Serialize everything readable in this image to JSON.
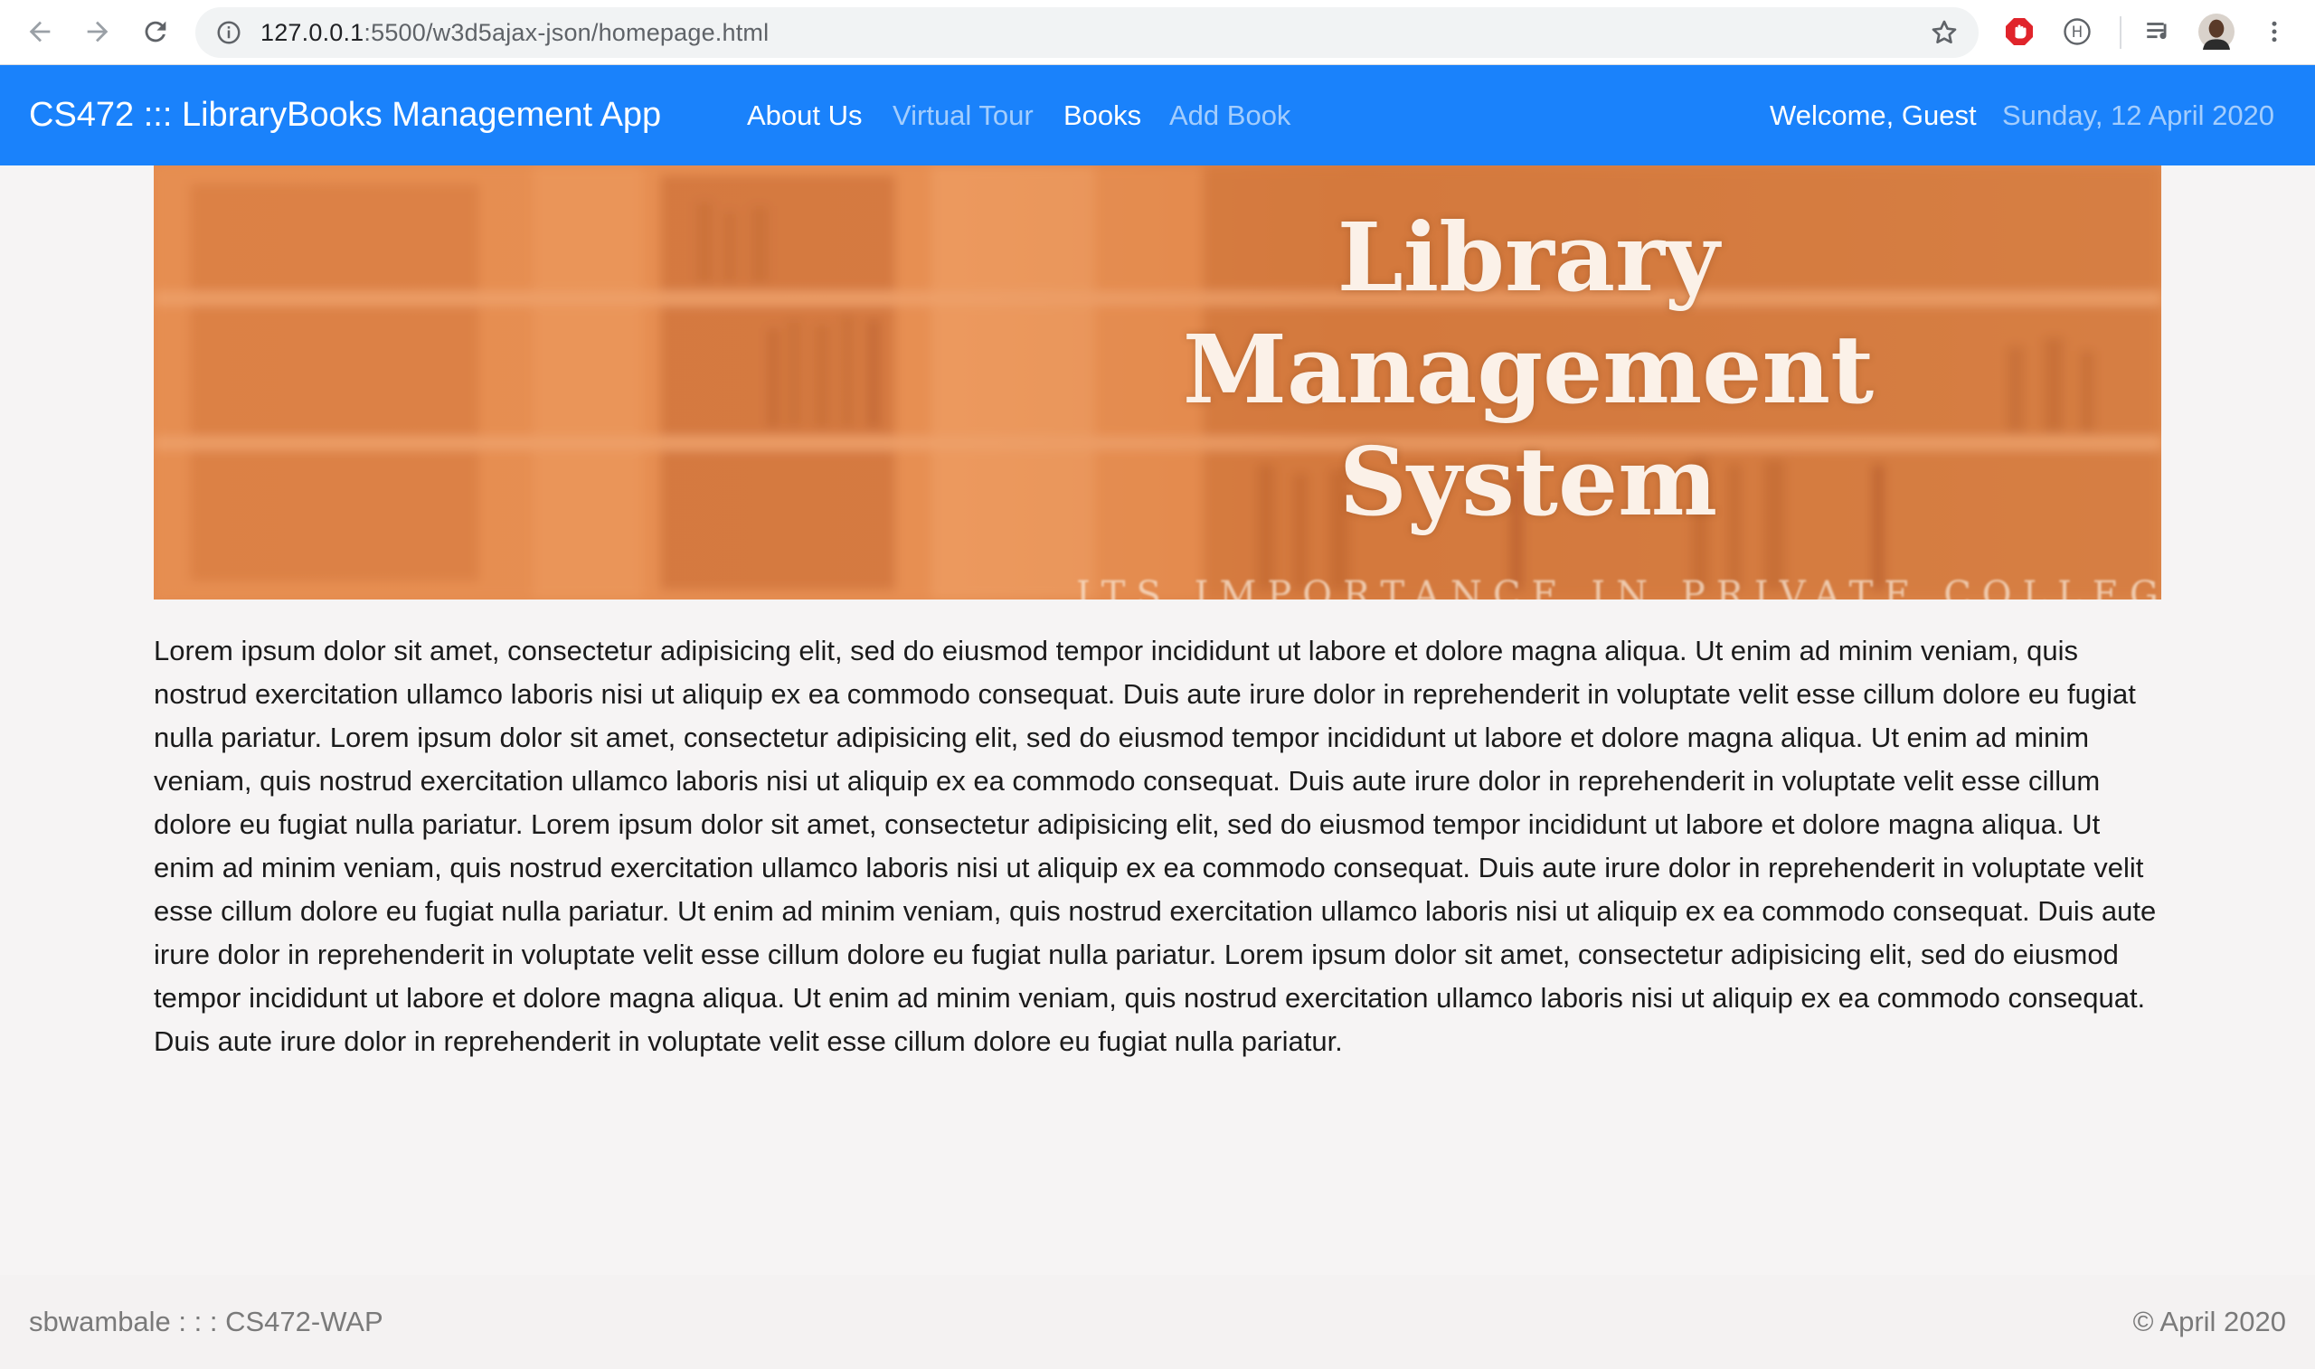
{
  "browser": {
    "url_host": "127.0.0.1",
    "url_path": ":5500/w3d5ajax-json/homepage.html",
    "icons": [
      "back-arrow-icon",
      "forward-arrow-icon",
      "reload-icon",
      "info-icon",
      "bookmark-star-icon",
      "adblock-stop-icon",
      "extension-h-icon",
      "media-playlist-icon",
      "profile-avatar-icon",
      "kebab-menu-icon"
    ]
  },
  "navbar": {
    "brand": "CS472 ::: LibraryBooks Management App",
    "links": [
      {
        "label": "About Us",
        "state": "active"
      },
      {
        "label": "Virtual Tour",
        "state": "muted"
      },
      {
        "label": "Books",
        "state": "active"
      },
      {
        "label": "Add Book",
        "state": "muted"
      }
    ],
    "welcome": "Welcome, Guest",
    "date": "Sunday, 12 April 2020",
    "color": "#1a82fb"
  },
  "banner": {
    "title_line1": "Library Management",
    "title_line2": "System",
    "subtitle": "ITS IMPORTANCE IN PRIVATE COLLEGES"
  },
  "main": {
    "paragraph": "Lorem ipsum dolor sit amet, consectetur adipisicing elit, sed do eiusmod tempor incididunt ut labore et dolore magna aliqua. Ut enim ad minim veniam, quis nostrud exercitation ullamco laboris nisi ut aliquip ex ea commodo consequat. Duis aute irure dolor in reprehenderit in voluptate velit esse cillum dolore eu fugiat nulla pariatur. Lorem ipsum dolor sit amet, consectetur adipisicing elit, sed do eiusmod tempor incididunt ut labore et dolore magna aliqua. Ut enim ad minim veniam, quis nostrud exercitation ullamco laboris nisi ut aliquip ex ea commodo consequat. Duis aute irure dolor in reprehenderit in voluptate velit esse cillum dolore eu fugiat nulla pariatur. Lorem ipsum dolor sit amet, consectetur adipisicing elit, sed do eiusmod tempor incididunt ut labore et dolore magna aliqua. Ut enim ad minim veniam, quis nostrud exercitation ullamco laboris nisi ut aliquip ex ea commodo consequat. Duis aute irure dolor in reprehenderit in voluptate velit esse cillum dolore eu fugiat nulla pariatur. Ut enim ad minim veniam, quis nostrud exercitation ullamco laboris nisi ut aliquip ex ea commodo consequat. Duis aute irure dolor in reprehenderit in voluptate velit esse cillum dolore eu fugiat nulla pariatur. Lorem ipsum dolor sit amet, consectetur adipisicing elit, sed do eiusmod tempor incididunt ut labore et dolore magna aliqua. Ut enim ad minim veniam, quis nostrud exercitation ullamco laboris nisi ut aliquip ex ea commodo consequat. Duis aute irure dolor in reprehenderit in voluptate velit esse cillum dolore eu fugiat nulla pariatur."
  },
  "footer": {
    "left": "sbwambale : : : CS472-WAP",
    "right": "© April 2020"
  }
}
